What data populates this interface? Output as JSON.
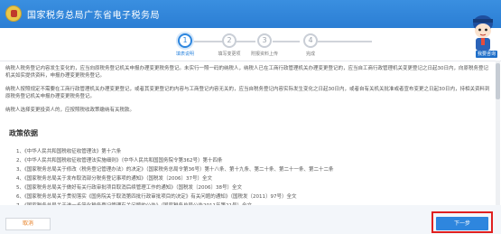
{
  "header": {
    "title": "国家税务总局广东省电子税务局"
  },
  "mascot": {
    "label": "我要咨询"
  },
  "steps": [
    {
      "num": "1",
      "label": "填表说明"
    },
    {
      "num": "2",
      "label": "填写变更项"
    },
    {
      "num": "3",
      "label": "附报资料上传"
    },
    {
      "num": "4",
      "label": "完成"
    }
  ],
  "content": {
    "para1": "纳税人税务登记内容发生变化的，应当向原税务登记机关申报办理变更税务登记。未实行一照一码的纳税人，纳税人已在工商行政管理机关办理变更登记的，应当自工商行政管理机关变更登记之日起30日内，向原税务登记机关如实提供资料，申报办理变更税务登记。",
    "para2": "纳税人按照规定不需要在工商行政管理机关办理变更登记，或者其变更登记的内容与工商登记内容无关的，应当自税务登记内容实际发生变化之日起30日内，或者自有关机关批准或者宣布变更之日起30日内，持相关资料到原税务登记机关申报办理变更税务登记。",
    "para3": "纳税人选择变更投资人的，应按照税收政策缴纳有关税款。",
    "policy_title": "政策依据",
    "laws": [
      "1、《中华人民共和国税收征收管理法》第十六条",
      "2、《中华人民共和国税收征收管理法实施细则》（中华人民共和国国务院令第362号）第十四条",
      "3、《国家税务总局关于修改〈税务登记管理办法〉的决定》（国家税务总局令第36号）第十八条、第十九条、第二十条、第二十一条、第二十二条",
      "4、《国家税务总局关于发布取消部分税务登记事项的通知》（国税发〔2006〕37号）全文",
      "5、《国家税务总局关于做好有关行政审批项目取消后续管理工作的通知》（国税发〔2006〕38号）全文",
      "6、《国家税务总局关于贯彻落实《国务院关于取消第四批行政审批项目的决定》有关问题的通知》（国税发〔2011〕97号）全文",
      "7、《国家税务总局关于进一步简化税务登记管理有关问题的公告》（国家税务总局公告2011年第21号）全文"
    ]
  },
  "footer": {
    "cancel_label": "取消",
    "next_label": "下一步"
  },
  "colors": {
    "header": "#2b7ed4",
    "accent": "#2e86de",
    "highlight": "#e02020"
  }
}
